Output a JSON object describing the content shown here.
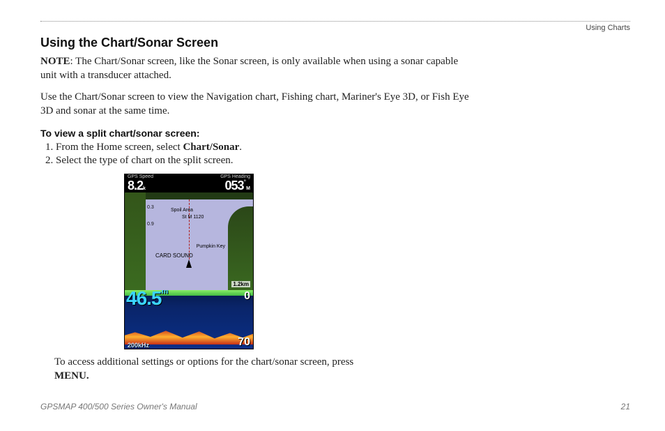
{
  "header": {
    "section": "Using Charts"
  },
  "title": "Using the Chart/Sonar Screen",
  "note_label": "NOTE",
  "note_text": ": The Chart/Sonar screen, like the Sonar screen, is only available when using a sonar capable unit with a transducer attached.",
  "intro_text": "Use the Chart/Sonar screen to view the Navigation chart, Fishing chart, Mariner's Eye 3D, or Fish Eye 3D and sonar at the same time.",
  "procedure_heading": "To view a split chart/sonar screen:",
  "steps": {
    "s1_pre": "From the Home screen, select ",
    "s1_strong": "Chart/Sonar",
    "s1_post": ".",
    "s2": "Select the type of chart on the split screen."
  },
  "figure": {
    "gps_speed_label": "GPS Speed",
    "gps_speed_value": "8.2",
    "gps_speed_unit": "k",
    "gps_heading_label": "GPS Heading",
    "gps_heading_value": "053",
    "gps_heading_unit": "M",
    "chart_labels": {
      "spoil": "Spoil Area",
      "stm": "St M 1120",
      "card": "CARD SOUND",
      "pump": "Pumpkin Key",
      "n03": "0.3",
      "n09": "0.9"
    },
    "chart_scale": "1.2km",
    "sonar": {
      "depth": "46.5",
      "depth_unit": "m",
      "top_scale": "0",
      "bottom_scale": "70",
      "freq": "200kHz"
    }
  },
  "caption_pre": "To access additional settings or options for the chart/sonar screen, press ",
  "caption_strong": "MENU.",
  "footer": {
    "manual": "GPSMAP 400/500 Series Owner's Manual",
    "page": "21"
  }
}
